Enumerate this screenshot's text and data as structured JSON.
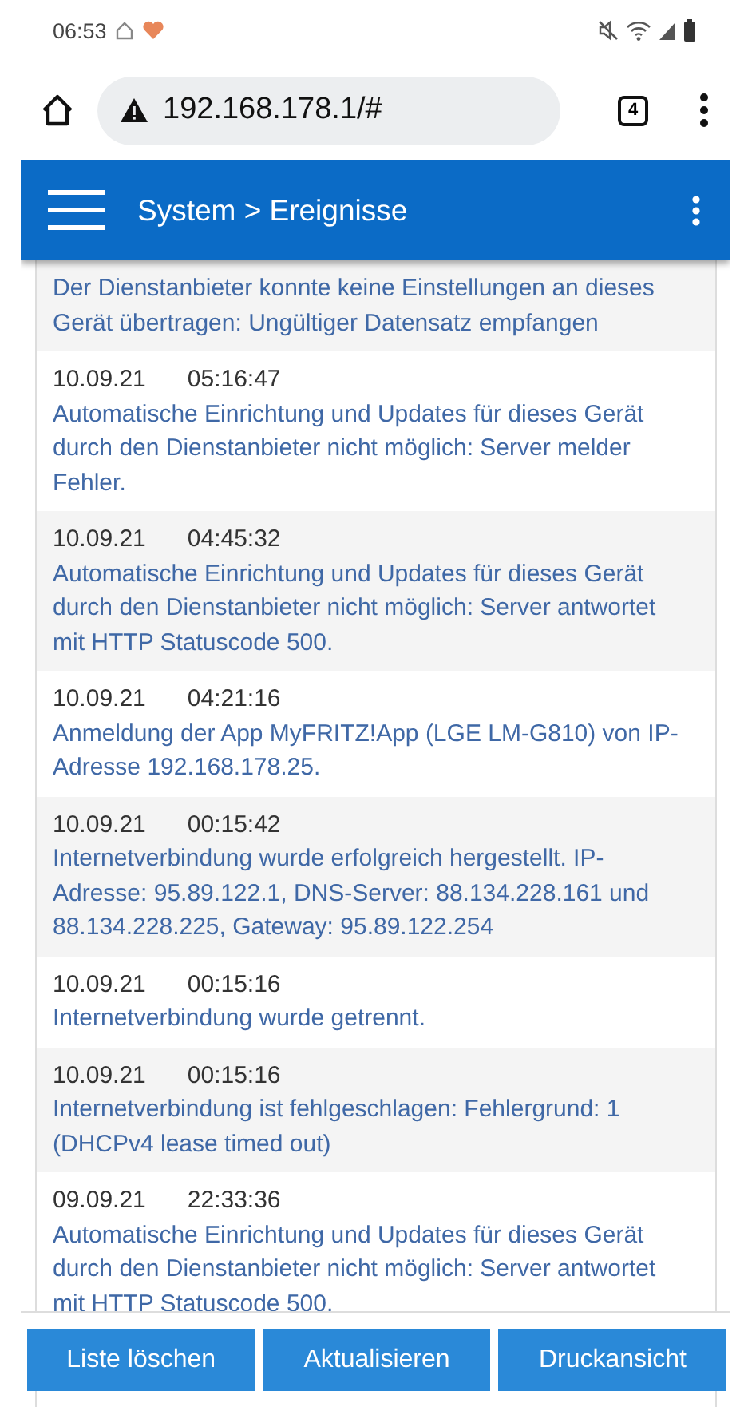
{
  "status_bar": {
    "time": "06:53"
  },
  "browser": {
    "url": "192.168.178.1/#",
    "tab_count": "4"
  },
  "header": {
    "title": "System > Ereignisse"
  },
  "events": [
    {
      "message": "Der Dienstanbieter konnte keine Einstellungen an dieses Gerät übertragen: Ungültiger Datensatz empfangen"
    },
    {
      "date": "10.09.21",
      "time": "05:16:47",
      "message": "Automatische Einrichtung und Updates für dieses Gerät durch den Dienstanbieter nicht möglich: Server melder Fehler."
    },
    {
      "date": "10.09.21",
      "time": "04:45:32",
      "message": "Automatische Einrichtung und Updates für dieses Gerät durch den Dienstanbieter nicht möglich: Server antwortet mit HTTP Statuscode 500."
    },
    {
      "date": "10.09.21",
      "time": "04:21:16",
      "message": "Anmeldung der App MyFRITZ!App (LGE LM-G810) von IP-Adresse 192.168.178.25."
    },
    {
      "date": "10.09.21",
      "time": "00:15:42",
      "message": "Internetverbindung wurde erfolgreich hergestellt. IP-Adresse: 95.89.122.1, DNS-Server: 88.134.228.161 und 88.134.228.225, Gateway: 95.89.122.254"
    },
    {
      "date": "10.09.21",
      "time": "00:15:16",
      "message": "Internetverbindung wurde getrennt."
    },
    {
      "date": "10.09.21",
      "time": "00:15:16",
      "message": "Internetverbindung ist fehlgeschlagen: Fehlergrund: 1 (DHCPv4 lease timed out)"
    },
    {
      "date": "09.09.21",
      "time": "22:33:36",
      "message": "Automatische Einrichtung und Updates für dieses Gerät durch den Dienstanbieter nicht möglich: Server antwortet mit HTTP Statuscode 500."
    }
  ],
  "buttons": [
    "Liste löschen",
    "Aktualisieren",
    "Druckansicht"
  ]
}
